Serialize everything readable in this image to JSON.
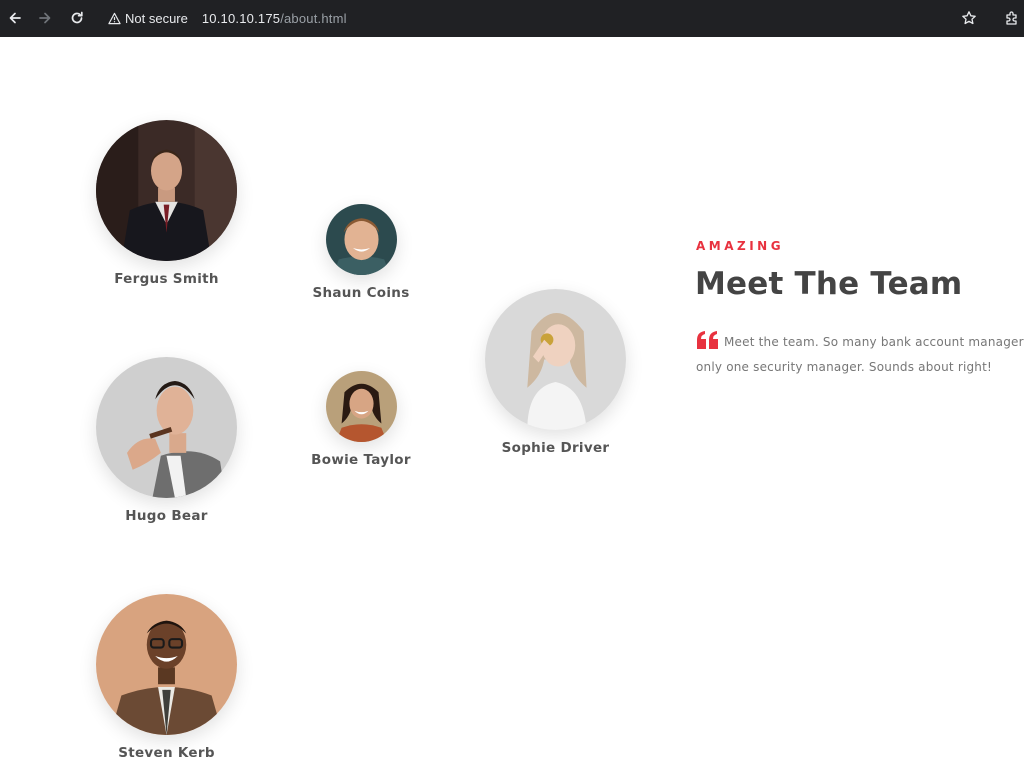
{
  "browser": {
    "security_label": "Not secure",
    "url_host": "10.10.10.175",
    "url_path": "/about.html",
    "icons": [
      "back-arrow-icon",
      "forward-arrow-icon",
      "reload-icon",
      "warning-icon",
      "star-icon",
      "extensions-icon"
    ]
  },
  "team": {
    "members": [
      {
        "name": "Fergus Smith"
      },
      {
        "name": "Shaun Coins"
      },
      {
        "name": "Sophie Driver"
      },
      {
        "name": "Hugo Bear"
      },
      {
        "name": "Bowie Taylor"
      },
      {
        "name": "Steven Kerb"
      }
    ]
  },
  "intro": {
    "eyebrow": "AMAZING",
    "heading": "Meet The Team",
    "quote_line_1": "Meet the team. So many bank account managers b",
    "quote_line_2": "only one security manager. Sounds about right!",
    "accent_color": "#e8323f"
  }
}
